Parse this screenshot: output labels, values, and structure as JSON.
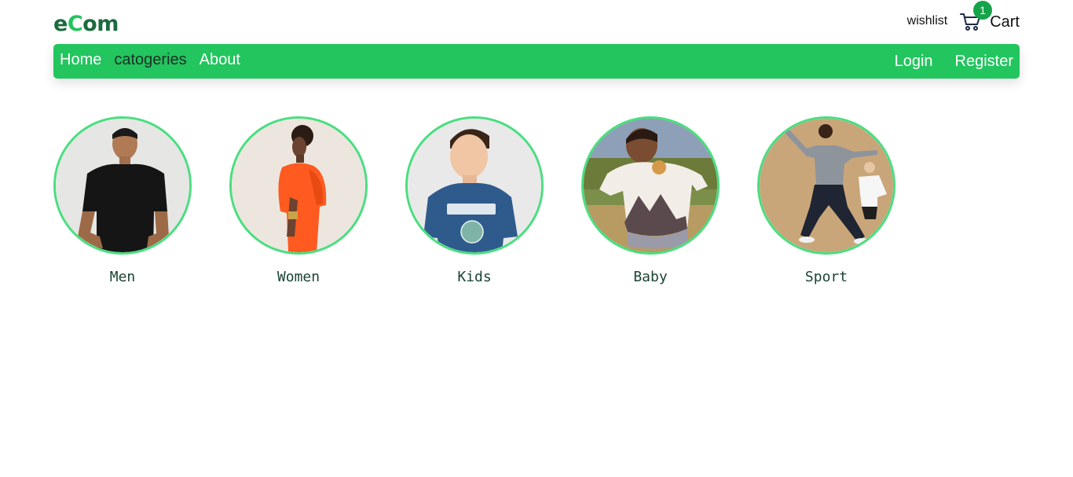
{
  "brand": {
    "logo_prefix": "e",
    "logo_accent": "C",
    "logo_suffix": "om"
  },
  "header": {
    "wishlist_label": "wishlist",
    "cart_label": "Cart",
    "cart_count": "1"
  },
  "nav": {
    "left": [
      "Home",
      "catogeries",
      "About"
    ],
    "right": [
      "Login",
      "Register"
    ]
  },
  "categories": [
    {
      "label": "Men"
    },
    {
      "label": "Women"
    },
    {
      "label": "Kids"
    },
    {
      "label": "Baby"
    },
    {
      "label": "Sport"
    }
  ],
  "colors": {
    "primary_green": "#22c55e",
    "logo_green": "#1b6b3e",
    "badge_green": "#16a34a",
    "circle_border": "#4ade80"
  }
}
